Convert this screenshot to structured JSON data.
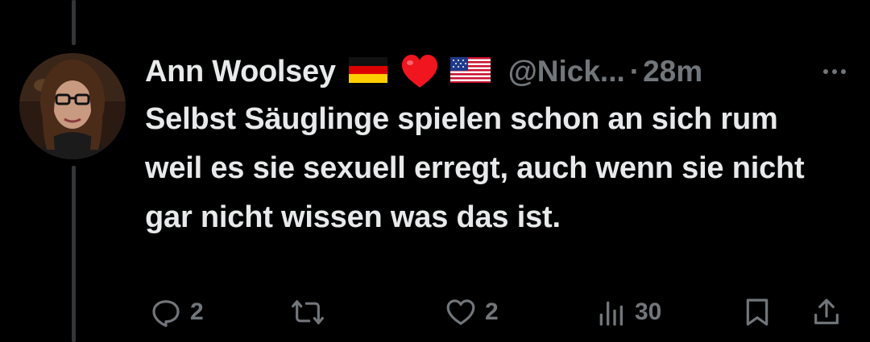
{
  "tweet": {
    "author_name": "Ann Woolsey",
    "handle": "@Nick...",
    "separator": "·",
    "time": "28m",
    "text": "Selbst Säuglinge spielen schon an sich rum weil es sie sexuell erregt, auch wenn sie nicht gar nicht wissen was das ist.",
    "name_emojis": [
      "german-flag",
      "red-heart",
      "us-flag"
    ]
  },
  "actions": {
    "reply_count": "2",
    "retweet_count": "",
    "like_count": "2",
    "views_count": "30"
  },
  "colors": {
    "background": "#000000",
    "text_primary": "#e7e9ea",
    "text_secondary": "#71767b",
    "thread_line": "#333639"
  }
}
